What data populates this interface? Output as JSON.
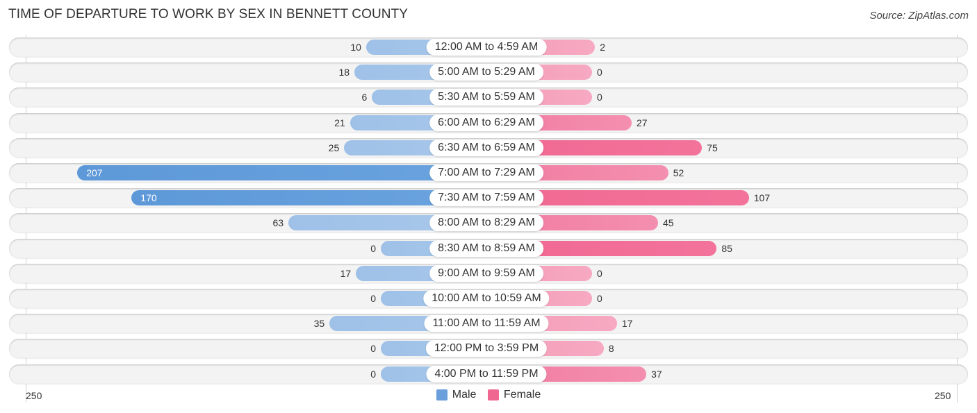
{
  "header": {
    "title": "TIME OF DEPARTURE TO WORK BY SEX IN BENNETT COUNTY",
    "source": "Source: ZipAtlas.com"
  },
  "colors": {
    "male": "#6a9fdc",
    "female": "#f06892"
  },
  "chart_data": {
    "type": "bar",
    "orientation": "horizontal-diverging",
    "title": "TIME OF DEPARTURE TO WORK BY SEX IN BENNETT COUNTY",
    "categories": [
      "12:00 AM to 4:59 AM",
      "5:00 AM to 5:29 AM",
      "5:30 AM to 5:59 AM",
      "6:00 AM to 6:29 AM",
      "6:30 AM to 6:59 AM",
      "7:00 AM to 7:29 AM",
      "7:30 AM to 7:59 AM",
      "8:00 AM to 8:29 AM",
      "8:30 AM to 8:59 AM",
      "9:00 AM to 9:59 AM",
      "10:00 AM to 10:59 AM",
      "11:00 AM to 11:59 AM",
      "12:00 PM to 3:59 PM",
      "4:00 PM to 11:59 PM"
    ],
    "series": [
      {
        "name": "Male",
        "values": [
          10,
          18,
          6,
          21,
          25,
          207,
          170,
          63,
          0,
          17,
          0,
          35,
          0,
          0
        ]
      },
      {
        "name": "Female",
        "values": [
          2,
          0,
          0,
          27,
          75,
          52,
          107,
          45,
          85,
          0,
          0,
          17,
          8,
          37
        ]
      }
    ],
    "axis": {
      "left_tick": "250",
      "right_tick": "250",
      "max": 250
    },
    "legend": {
      "position": "bottom-center",
      "entries": [
        "Male",
        "Female"
      ]
    },
    "xlabel": "",
    "ylabel": ""
  }
}
